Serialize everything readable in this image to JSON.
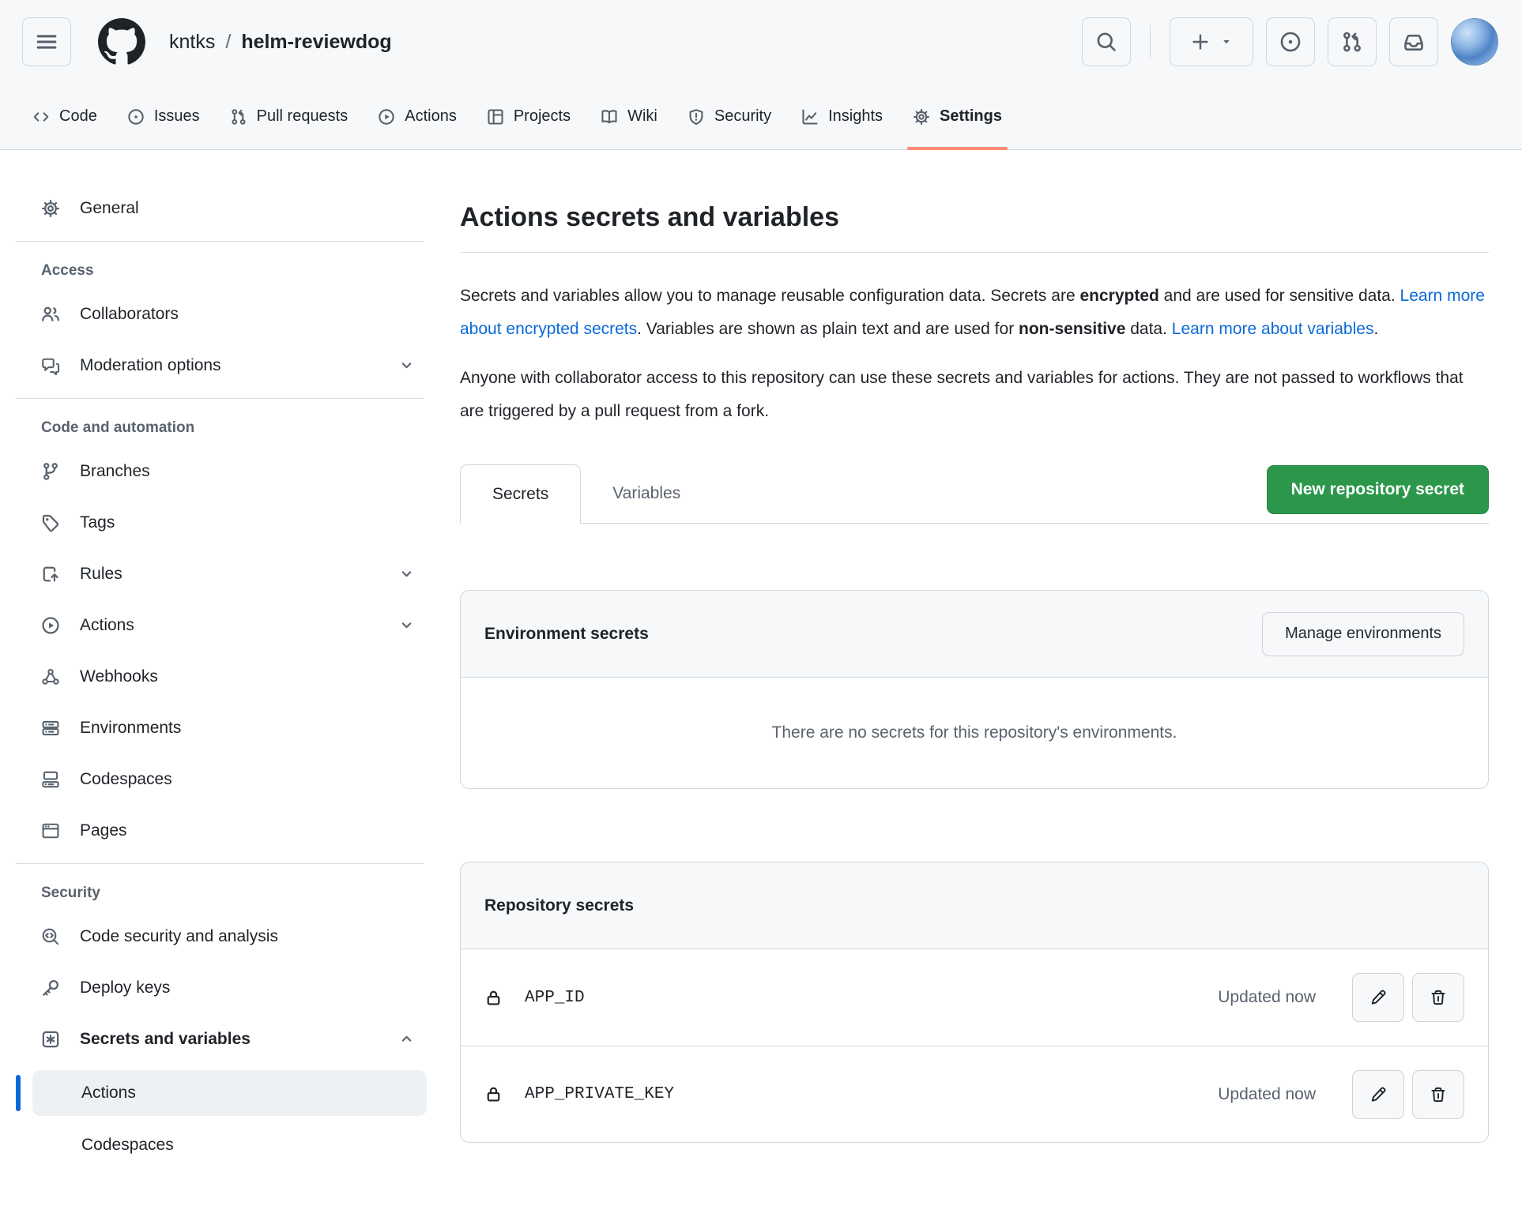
{
  "header": {
    "owner": "kntks",
    "separator": "/",
    "repo": "helm-reviewdog"
  },
  "nav": {
    "tabs": [
      {
        "label": "Code",
        "icon": "code-icon",
        "active": false
      },
      {
        "label": "Issues",
        "icon": "issue-opened-icon",
        "active": false
      },
      {
        "label": "Pull requests",
        "icon": "git-pull-request-icon",
        "active": false
      },
      {
        "label": "Actions",
        "icon": "play-icon",
        "active": false
      },
      {
        "label": "Projects",
        "icon": "table-icon",
        "active": false
      },
      {
        "label": "Wiki",
        "icon": "book-icon",
        "active": false
      },
      {
        "label": "Security",
        "icon": "shield-icon",
        "active": false
      },
      {
        "label": "Insights",
        "icon": "graph-icon",
        "active": false
      },
      {
        "label": "Settings",
        "icon": "gear-icon",
        "active": true
      }
    ]
  },
  "sidebar": {
    "general": "General",
    "access_title": "Access",
    "collaborators": "Collaborators",
    "moderation": "Moderation options",
    "code_title": "Code and automation",
    "branches": "Branches",
    "tags": "Tags",
    "rules": "Rules",
    "actions": "Actions",
    "webhooks": "Webhooks",
    "environments": "Environments",
    "codespaces": "Codespaces",
    "pages": "Pages",
    "security_title": "Security",
    "code_security": "Code security and analysis",
    "deploy_keys": "Deploy keys",
    "secrets_variables": "Secrets and variables",
    "sub_actions": "Actions",
    "sub_codespaces": "Codespaces"
  },
  "main": {
    "title": "Actions secrets and variables",
    "intro": {
      "s1": "Secrets and variables allow you to manage reusable configuration data. Secrets are ",
      "b1": "encrypted",
      "s2": " and are used for sensitive data. ",
      "link1": "Learn more about encrypted secrets",
      "s3": ". Variables are shown as plain text and are used for ",
      "b2": "non-sensitive",
      "s4": " data. ",
      "link2": "Learn more about variables",
      "s5": "."
    },
    "paragraph2": "Anyone with collaborator access to this repository can use these secrets and variables for actions. They are not passed to workflows that are triggered by a pull request from a fork.",
    "tabs": {
      "secrets": "Secrets",
      "variables": "Variables"
    },
    "new_secret_button": "New repository secret",
    "env": {
      "title": "Environment secrets",
      "manage_button": "Manage environments",
      "empty": "There are no secrets for this repository's environments."
    },
    "repo_secrets": {
      "title": "Repository secrets",
      "rows": [
        {
          "name": "APP_ID",
          "updated": "Updated now"
        },
        {
          "name": "APP_PRIVATE_KEY",
          "updated": "Updated now"
        }
      ]
    }
  },
  "colors": {
    "header_bg": "#f6f8fa",
    "border": "#d0d7de",
    "muted_text": "#59636e",
    "link_blue": "#0969da",
    "accent_green": "#2c974b",
    "tab_underline": "#fd8c73",
    "active_indicator": "#0969da"
  }
}
